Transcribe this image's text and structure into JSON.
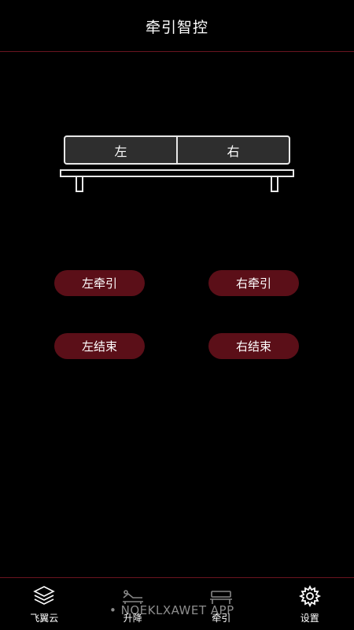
{
  "header": {
    "title": "牵引智控"
  },
  "bed": {
    "left_label": "左",
    "right_label": "右"
  },
  "controls": {
    "left_traction": "左牵引",
    "right_traction": "右牵引",
    "left_end": "左结束",
    "right_end": "右结束"
  },
  "nav": {
    "items": [
      {
        "label": "飞翼云",
        "icon": "layers-icon"
      },
      {
        "label": "升降",
        "icon": "adjustable-bed-icon"
      },
      {
        "label": "牵引",
        "icon": "bed-icon"
      },
      {
        "label": "设置",
        "icon": "gear-icon"
      }
    ]
  },
  "watermark": "• NOEKLXAWET APP",
  "colors": {
    "accent": "#5b0f18",
    "divider": "#6a1420",
    "background": "#000000"
  }
}
